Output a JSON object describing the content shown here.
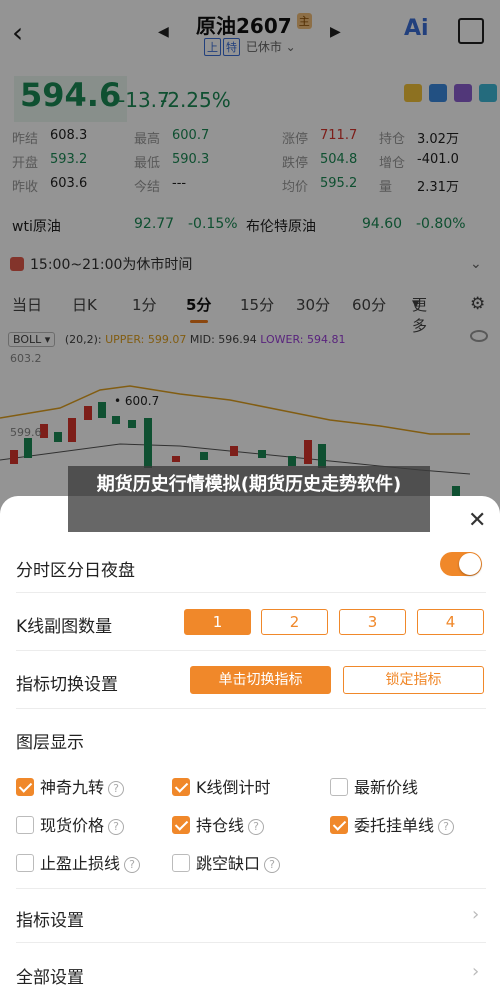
{
  "header": {
    "title": "原油2607",
    "title_badge": "主",
    "status_tags": [
      "上",
      "特"
    ],
    "status_text": "已休市",
    "ai_label": "Ai"
  },
  "quote": {
    "price": "594.6",
    "change": "-13.7",
    "change_pct": "-2.25%",
    "rows": [
      [
        {
          "label": "昨结",
          "value": "608.3",
          "color": "plain"
        },
        {
          "label": "最高",
          "value": "600.7",
          "color": "grn"
        },
        {
          "label": "涨停",
          "value": "711.7",
          "color": "red"
        },
        {
          "label": "持仓",
          "value": "3.02万",
          "color": "plain"
        }
      ],
      [
        {
          "label": "开盘",
          "value": "593.2",
          "color": "grn"
        },
        {
          "label": "最低",
          "value": "590.3",
          "color": "grn"
        },
        {
          "label": "跌停",
          "value": "504.8",
          "color": "grn"
        },
        {
          "label": "增仓",
          "value": "-401.0",
          "color": "plain"
        }
      ],
      [
        {
          "label": "昨收",
          "value": "603.6",
          "color": "plain"
        },
        {
          "label": "今结",
          "value": "---",
          "color": "plain"
        },
        {
          "label": "均价",
          "value": "595.2",
          "color": "grn"
        },
        {
          "label": "量",
          "value": "2.31万",
          "color": "plain"
        }
      ]
    ]
  },
  "related": [
    {
      "name": "wti原油",
      "price": "92.77",
      "pct": "-0.15%"
    },
    {
      "name": "布伦特原油",
      "price": "94.60",
      "pct": "-0.80%"
    }
  ],
  "notice": "15:00~21:00为休市时间",
  "tabs": [
    "当日",
    "日K",
    "1分",
    "5分",
    "15分",
    "30分",
    "60分",
    "更多"
  ],
  "boll": {
    "name": "BOLL",
    "params": "(20,2):",
    "upper": "UPPER: 599.07",
    "mid": "MID: 596.94",
    "lower": "LOWER: 594.81"
  },
  "chart": {
    "y_top_label": "603.2",
    "y_mid_label": "599.6",
    "high_marker": "600.7"
  },
  "caption": "期货历史行情模拟(期货历史走势软件)",
  "settings": {
    "split_night": "分时区分日夜盘",
    "kline_count_label": "K线副图数量",
    "kline_options": [
      "1",
      "2",
      "3",
      "4"
    ],
    "indicator_switch_label": "指标切换设置",
    "click_switch": "单击切换指标",
    "lock_indicator": "锁定指标",
    "layers_label": "图层显示",
    "layers": [
      {
        "label": "神奇九转",
        "checked": true,
        "help": true
      },
      {
        "label": "K线倒计时",
        "checked": true,
        "help": false
      },
      {
        "label": "最新价线",
        "checked": false,
        "help": false
      },
      {
        "label": "现货价格",
        "checked": false,
        "help": true
      },
      {
        "label": "持仓线",
        "checked": true,
        "help": true
      },
      {
        "label": "委托挂单线",
        "checked": true,
        "help": true
      },
      {
        "label": "止盈止损线",
        "checked": false,
        "help": true
      },
      {
        "label": "跳空缺口",
        "checked": false,
        "help": true
      }
    ],
    "indicator_settings": "指标设置",
    "all_settings": "全部设置"
  },
  "colors": {
    "accent": "#f0882a",
    "up": "#d8342c",
    "down": "#1b8a55"
  }
}
